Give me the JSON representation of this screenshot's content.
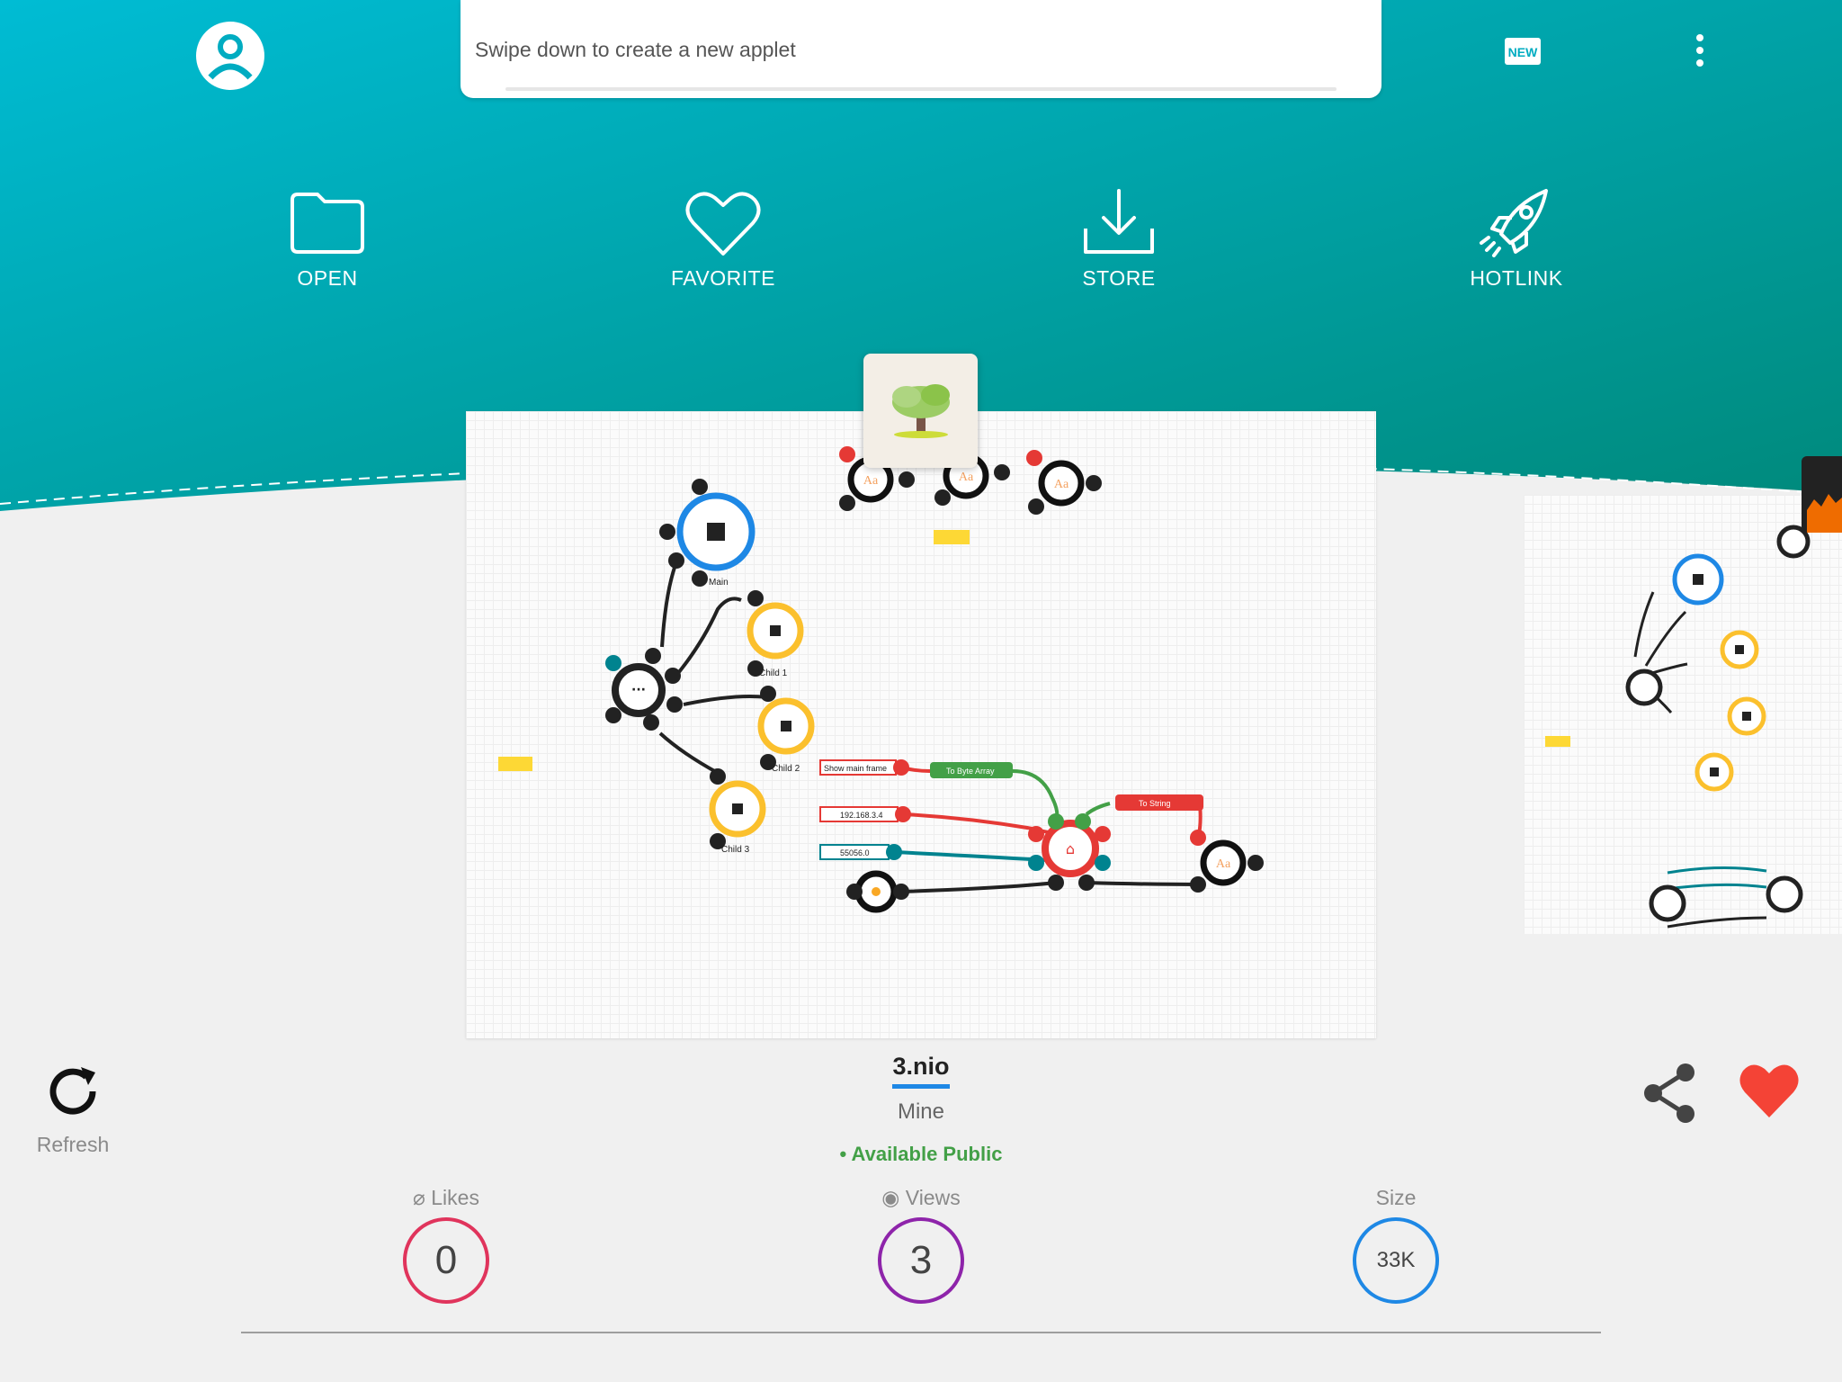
{
  "header": {
    "swipe_hint": "Swipe down to create a new applet",
    "new_badge": "NEW"
  },
  "actions": [
    {
      "label": "OPEN",
      "icon": "folder-icon"
    },
    {
      "label": "FAVORITE",
      "icon": "heart-outline-icon"
    },
    {
      "label": "STORE",
      "icon": "download-icon"
    },
    {
      "label": "HOTLINK",
      "icon": "rocket-icon"
    }
  ],
  "preview": {
    "nodes": {
      "main": "Main",
      "child1": "Child 1",
      "child2": "Child 2",
      "child3": "Child 3",
      "show_main_frame": "Show main frame",
      "to_byte_array": "To Byte Array",
      "ip": "192.168.3.4",
      "port": "55056.0",
      "to_string": "To String"
    }
  },
  "applet": {
    "name": "3.nio",
    "owner": "Mine",
    "visibility": "• Available Public"
  },
  "refresh_label": "Refresh",
  "stats": {
    "likes_label": "Likes",
    "likes_value": "0",
    "views_label": "Views",
    "views_value": "3",
    "size_label": "Size",
    "size_value": "33K"
  },
  "colors": {
    "header_start": "#00b8d0",
    "header_end": "#00897b",
    "likes_ring": "#e0345c",
    "views_ring": "#8e24aa",
    "size_ring": "#1e88e5",
    "heart": "#f44336",
    "public": "#43a047"
  }
}
